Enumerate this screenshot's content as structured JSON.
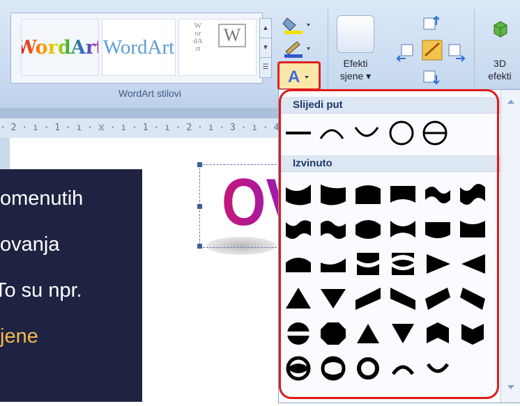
{
  "ribbon": {
    "gallery_items": [
      "WordArt",
      "WordArt",
      "WordArt",
      "W"
    ],
    "group_label": "WordArt stilovi",
    "shadow_button": [
      "Efekti",
      "sjene ▾"
    ],
    "effects_3d_button": [
      "3D",
      "efekti"
    ]
  },
  "ruler": {
    "text": "· 2 · ı · 1 · ı · ⧖ · ı · 1 · ı · 2 · ı · 3 · ı · 4 ·"
  },
  "slide": {
    "lines": [
      "omenutih",
      "ovanja",
      "To su npr.",
      "jene"
    ],
    "highlight_color": "#f5b94a"
  },
  "wordart_text": "OV",
  "dropdown": {
    "section1": "Slijedi put",
    "section2": "Izvinuto"
  },
  "colors": {
    "frame": "#e01818",
    "slide_bg": "#1e2342",
    "ribbon_bg": "#c9dbf0"
  }
}
